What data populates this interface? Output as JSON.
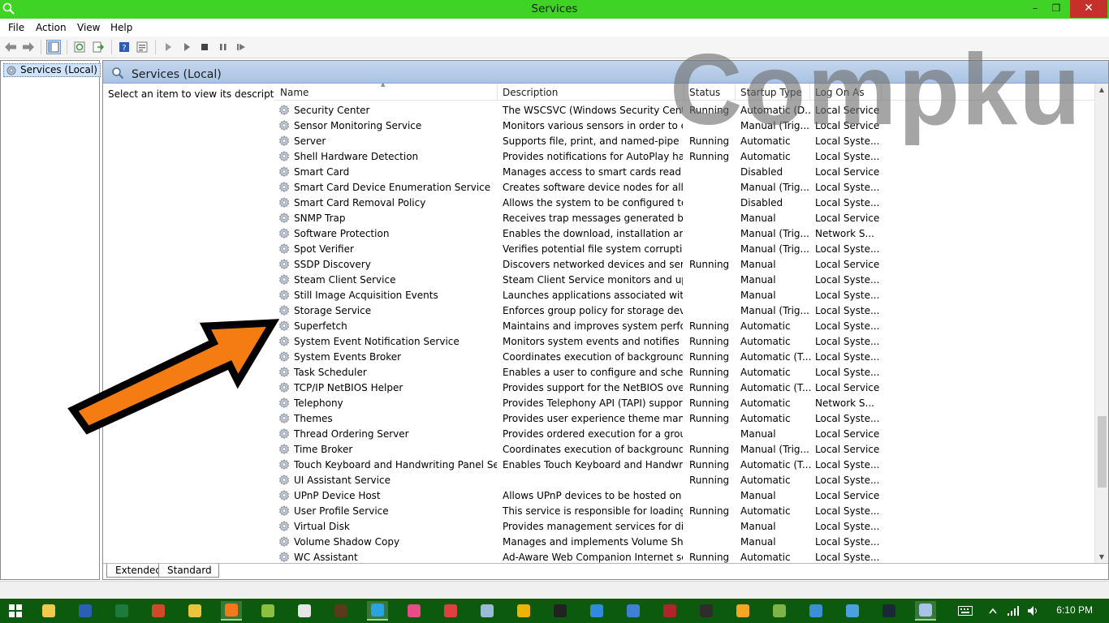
{
  "window": {
    "title": "Services",
    "minimize": "–",
    "maximize": "❐",
    "close": "✕"
  },
  "menu": [
    {
      "label": "File"
    },
    {
      "label": "Action"
    },
    {
      "label": "View"
    },
    {
      "label": "Help"
    }
  ],
  "tree": {
    "node_label": "Services (Local)"
  },
  "pane": {
    "title": "Services (Local)",
    "description_hint": "Select an item to view its description."
  },
  "columns": {
    "name": "Name",
    "description": "Description",
    "status": "Status",
    "startup_type": "Startup Type",
    "log_on_as": "Log On As"
  },
  "services": [
    {
      "name": "Security Center",
      "description": "The WSCSVC (Windows Security Center...",
      "status": "Running",
      "startup": "Automatic (D...",
      "logon": "Local Service"
    },
    {
      "name": "Sensor Monitoring Service",
      "description": "Monitors various sensors in order to ex...",
      "status": "",
      "startup": "Manual (Trig...",
      "logon": "Local Service"
    },
    {
      "name": "Server",
      "description": "Supports file, print, and named-pipe sh...",
      "status": "Running",
      "startup": "Automatic",
      "logon": "Local Syste..."
    },
    {
      "name": "Shell Hardware Detection",
      "description": "Provides notifications for AutoPlay har...",
      "status": "Running",
      "startup": "Automatic",
      "logon": "Local Syste..."
    },
    {
      "name": "Smart Card",
      "description": "Manages access to smart cards read by ...",
      "status": "",
      "startup": "Disabled",
      "logon": "Local Service"
    },
    {
      "name": "Smart Card Device Enumeration Service",
      "description": "Creates software device nodes for all s...",
      "status": "",
      "startup": "Manual (Trig...",
      "logon": "Local Syste..."
    },
    {
      "name": "Smart Card Removal Policy",
      "description": "Allows the system to be configured to l...",
      "status": "",
      "startup": "Disabled",
      "logon": "Local Syste..."
    },
    {
      "name": "SNMP Trap",
      "description": "Receives trap messages generated by lo...",
      "status": "",
      "startup": "Manual",
      "logon": "Local Service"
    },
    {
      "name": "Software Protection",
      "description": "Enables the download, installation and ...",
      "status": "",
      "startup": "Manual (Trig...",
      "logon": "Network S..."
    },
    {
      "name": "Spot Verifier",
      "description": "Verifies potential file system corruptions.",
      "status": "",
      "startup": "Manual (Trig...",
      "logon": "Local Syste..."
    },
    {
      "name": "SSDP Discovery",
      "description": "Discovers networked devices and servic...",
      "status": "Running",
      "startup": "Manual",
      "logon": "Local Service"
    },
    {
      "name": "Steam Client Service",
      "description": "Steam Client Service monitors and upd...",
      "status": "",
      "startup": "Manual",
      "logon": "Local Syste..."
    },
    {
      "name": "Still Image Acquisition Events",
      "description": "Launches applications associated with s...",
      "status": "",
      "startup": "Manual",
      "logon": "Local Syste..."
    },
    {
      "name": "Storage Service",
      "description": "Enforces group policy for storage devices",
      "status": "",
      "startup": "Manual (Trig...",
      "logon": "Local Syste..."
    },
    {
      "name": "Superfetch",
      "description": "Maintains and improves system perfor...",
      "status": "Running",
      "startup": "Automatic",
      "logon": "Local Syste..."
    },
    {
      "name": "System Event Notification Service",
      "description": "Monitors system events and notifies su...",
      "status": "Running",
      "startup": "Automatic",
      "logon": "Local Syste..."
    },
    {
      "name": "System Events Broker",
      "description": "Coordinates execution of background ...",
      "status": "Running",
      "startup": "Automatic (T...",
      "logon": "Local Syste..."
    },
    {
      "name": "Task Scheduler",
      "description": "Enables a user to configure and schedul...",
      "status": "Running",
      "startup": "Automatic",
      "logon": "Local Syste..."
    },
    {
      "name": "TCP/IP NetBIOS Helper",
      "description": "Provides support for the NetBIOS over ...",
      "status": "Running",
      "startup": "Automatic (T...",
      "logon": "Local Service"
    },
    {
      "name": "Telephony",
      "description": "Provides Telephony API (TAPI) support ...",
      "status": "Running",
      "startup": "Automatic",
      "logon": "Network S..."
    },
    {
      "name": "Themes",
      "description": "Provides user experience theme manag...",
      "status": "Running",
      "startup": "Automatic",
      "logon": "Local Syste..."
    },
    {
      "name": "Thread Ordering Server",
      "description": "Provides ordered execution for a group ...",
      "status": "",
      "startup": "Manual",
      "logon": "Local Service"
    },
    {
      "name": "Time Broker",
      "description": "Coordinates execution of background ...",
      "status": "Running",
      "startup": "Manual (Trig...",
      "logon": "Local Service"
    },
    {
      "name": "Touch Keyboard and Handwriting Panel Servi...",
      "description": "Enables Touch Keyboard and Handwriti...",
      "status": "Running",
      "startup": "Automatic (T...",
      "logon": "Local Syste..."
    },
    {
      "name": "UI Assistant Service",
      "description": "",
      "status": "Running",
      "startup": "Automatic",
      "logon": "Local Syste..."
    },
    {
      "name": "UPnP Device Host",
      "description": "Allows UPnP devices to be hosted on th...",
      "status": "",
      "startup": "Manual",
      "logon": "Local Service"
    },
    {
      "name": "User Profile Service",
      "description": "This service is responsible for loading a...",
      "status": "Running",
      "startup": "Automatic",
      "logon": "Local Syste..."
    },
    {
      "name": "Virtual Disk",
      "description": "Provides management services for disk...",
      "status": "",
      "startup": "Manual",
      "logon": "Local Syste..."
    },
    {
      "name": "Volume Shadow Copy",
      "description": "Manages and implements Volume Sha...",
      "status": "",
      "startup": "Manual",
      "logon": "Local Syste..."
    },
    {
      "name": "WC Assistant",
      "description": "Ad-Aware Web Companion Internet se...",
      "status": "Running",
      "startup": "Automatic",
      "logon": "Local Syste..."
    }
  ],
  "tabs": {
    "extended": "Extended",
    "standard": "Standard"
  },
  "watermark": "Compku",
  "taskbar": {
    "clock": "6:10 PM",
    "apps": [
      {
        "icon": "file-explorer-icon",
        "color": "#f2c94c"
      },
      {
        "icon": "word-icon",
        "color": "#2b5fb5"
      },
      {
        "icon": "excel-icon",
        "color": "#1e7a3c"
      },
      {
        "icon": "powerpoint-icon",
        "color": "#d04a2a"
      },
      {
        "icon": "chrome-icon",
        "color": "#e9c43c"
      },
      {
        "icon": "firefox-icon",
        "color": "#f27a1a"
      },
      {
        "icon": "app-icon",
        "color": "#8cbf3f"
      },
      {
        "icon": "app-icon",
        "color": "#e6e6e6"
      },
      {
        "icon": "media-icon",
        "color": "#5a3a1a"
      },
      {
        "icon": "telegram-icon",
        "color": "#2aa3df"
      },
      {
        "icon": "osu-icon",
        "color": "#ea4c89"
      },
      {
        "icon": "app-icon",
        "color": "#e04040"
      },
      {
        "icon": "app-icon",
        "color": "#9bbbd8"
      },
      {
        "icon": "app-icon",
        "color": "#f0b400"
      },
      {
        "icon": "terminal-icon",
        "color": "#222222"
      },
      {
        "icon": "app-icon",
        "color": "#2e8be0"
      },
      {
        "icon": "clock-icon",
        "color": "#3f7fd6"
      },
      {
        "icon": "app-icon",
        "color": "#b0242c"
      },
      {
        "icon": "app-icon",
        "color": "#2d2d2d"
      },
      {
        "icon": "app-icon",
        "color": "#f6a623"
      },
      {
        "icon": "app-icon",
        "color": "#7fb548"
      },
      {
        "icon": "gear-icon",
        "color": "#3a8fd8"
      },
      {
        "icon": "app-icon",
        "color": "#4ba0e0"
      },
      {
        "icon": "steam-icon",
        "color": "#1b2838"
      },
      {
        "icon": "services-icon",
        "color": "#a9c3e6"
      }
    ]
  }
}
